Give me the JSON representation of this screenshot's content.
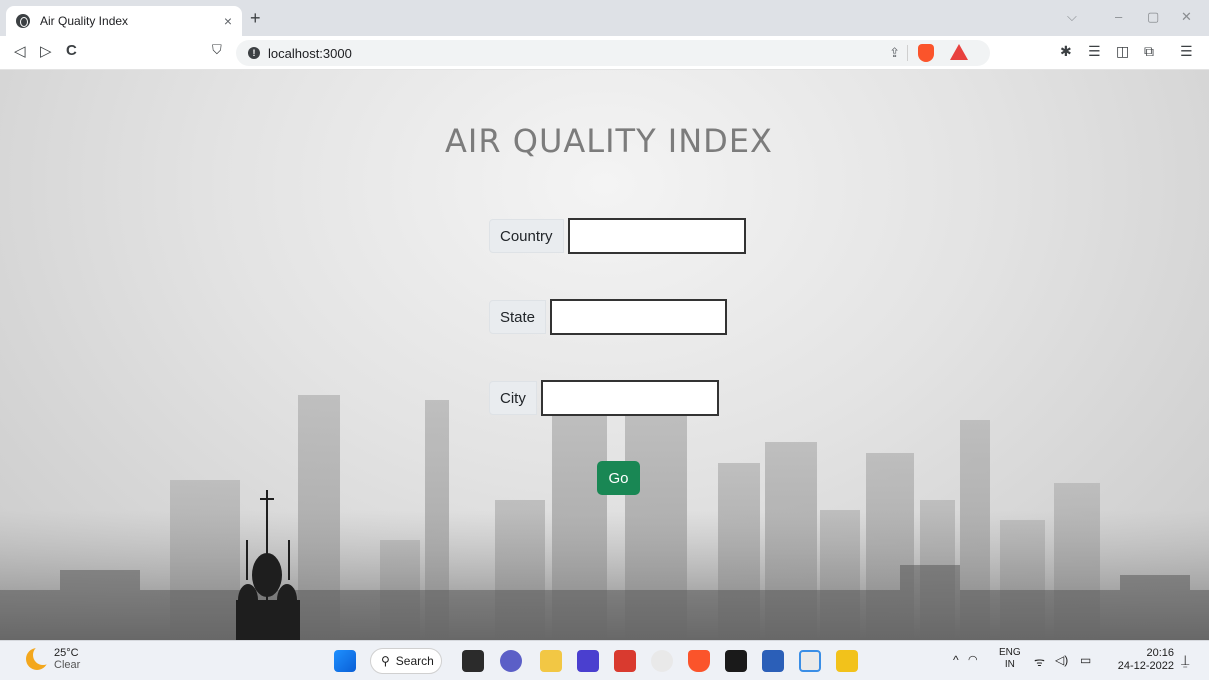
{
  "browser": {
    "tab_title": "Air Quality Index",
    "tab_close": "×",
    "new_tab": "+",
    "url": "localhost:3000",
    "window_controls": {
      "dropdown": "⌵",
      "minimize": "–",
      "restore": "▢",
      "close": "✕"
    },
    "nav": {
      "back": "◁",
      "forward": "▷",
      "reload": "C",
      "bookmark": "⛉"
    },
    "extensions": {
      "puzzle": "✱",
      "reading_list": "☰",
      "sidebar": "◫",
      "wallet": "⧉",
      "menu": "☰"
    }
  },
  "page": {
    "heading": "AIR QUALITY INDEX",
    "fields": [
      {
        "label": "Country",
        "value": ""
      },
      {
        "label": "State",
        "value": ""
      },
      {
        "label": "City",
        "value": ""
      }
    ],
    "go_label": "Go"
  },
  "taskbar": {
    "weather_temp": "25°C",
    "weather_desc": "Clear",
    "search_label": "Search",
    "lang_top": "ENG",
    "lang_bottom": "IN",
    "time": "20:16",
    "date": "24-12-2022",
    "tray_chevron": "^",
    "tray_icons": "◠  ᯤ ◁) ▭",
    "bell": "⍊"
  },
  "colors": {
    "go_button": "#198754",
    "heading": "#7c7c7c"
  }
}
